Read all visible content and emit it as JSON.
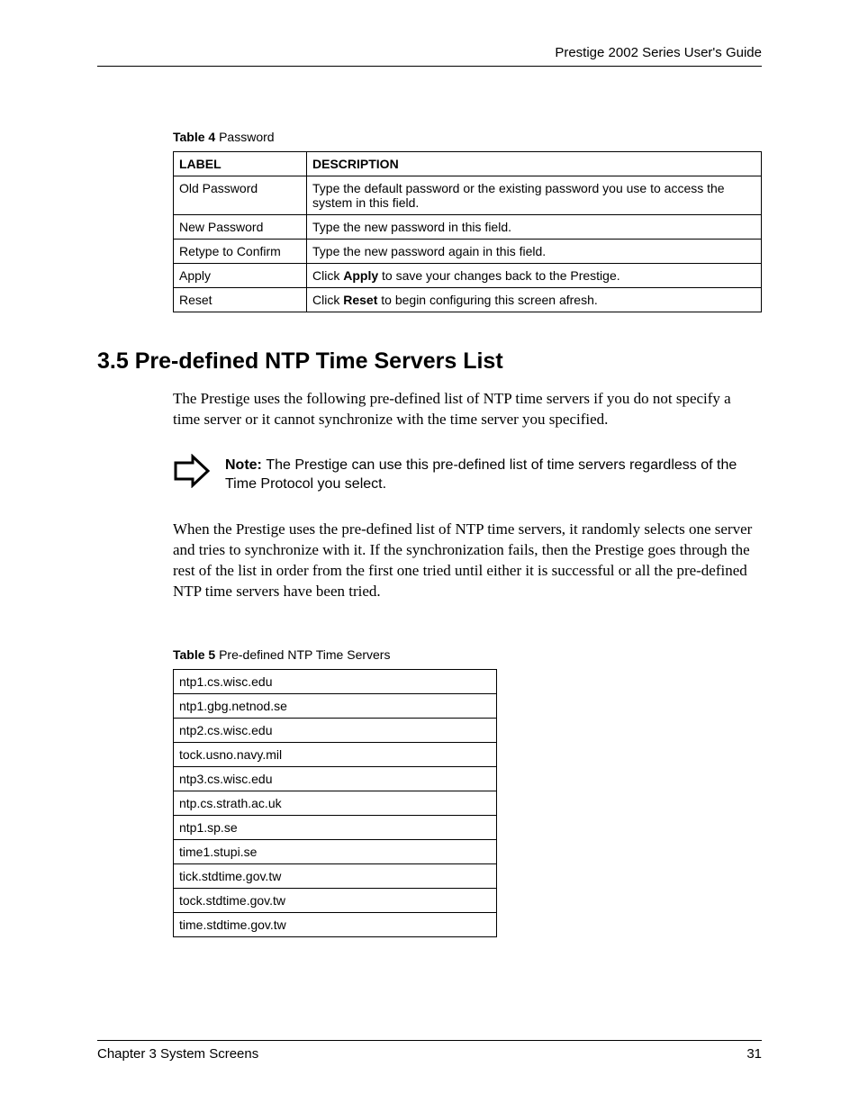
{
  "header": {
    "title": "Prestige 2002 Series User's Guide"
  },
  "table4": {
    "caption_bold": "Table 4",
    "caption_rest": "   Password",
    "headers": {
      "col1": "LABEL",
      "col2": "DESCRIPTION"
    },
    "rows": [
      {
        "label": "Old Password",
        "desc_pre": "Type the default password or the existing password you use to access the system in this field.",
        "bold": "",
        "desc_post": ""
      },
      {
        "label": "New Password",
        "desc_pre": "Type the new password in this field.",
        "bold": "",
        "desc_post": ""
      },
      {
        "label": "Retype to Confirm",
        "desc_pre": "Type the new password again in this field.",
        "bold": "",
        "desc_post": ""
      },
      {
        "label": "Apply",
        "desc_pre": "Click ",
        "bold": "Apply",
        "desc_post": " to save your changes back to the Prestige."
      },
      {
        "label": "Reset",
        "desc_pre": "Click ",
        "bold": "Reset",
        "desc_post": " to begin configuring this screen afresh."
      }
    ]
  },
  "section": {
    "heading": "3.5  Pre-defined NTP Time Servers List",
    "para1": "The Prestige uses the following pre-defined list of NTP time servers if you do not specify a time server or it cannot synchronize with the time server you specified.",
    "note_label": "Note: ",
    "note_text": "The Prestige can use this pre-defined list of time servers regardless of the Time Protocol you select.",
    "para2": "When the Prestige uses the pre-defined list of NTP time servers, it randomly selects one server and tries to synchronize with it. If the synchronization fails, then the Prestige goes through the rest of the list in order from the first one tried until either it is successful or all the pre-defined NTP time servers have been tried."
  },
  "table5": {
    "caption_bold": "Table 5",
    "caption_rest": "   Pre-defined NTP Time Servers",
    "rows": [
      "ntp1.cs.wisc.edu",
      "ntp1.gbg.netnod.se",
      "ntp2.cs.wisc.edu",
      "tock.usno.navy.mil",
      "ntp3.cs.wisc.edu",
      "ntp.cs.strath.ac.uk",
      "ntp1.sp.se",
      "time1.stupi.se",
      "tick.stdtime.gov.tw",
      "tock.stdtime.gov.tw",
      "time.stdtime.gov.tw"
    ]
  },
  "footer": {
    "left": "Chapter 3 System Screens",
    "right": "31"
  }
}
